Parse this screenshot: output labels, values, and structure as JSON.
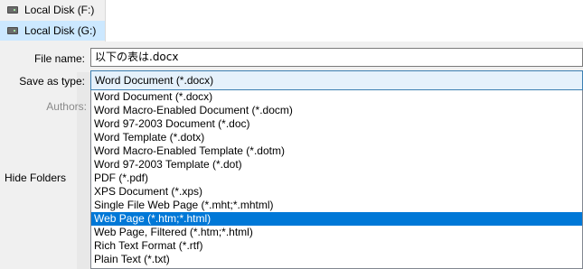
{
  "nav": {
    "items": [
      {
        "label": "Local Disk (F:)",
        "icon": "drive-icon",
        "selected": false
      },
      {
        "label": "Local Disk (G:)",
        "icon": "drive-icon",
        "selected": true
      }
    ]
  },
  "form": {
    "file_name_label": "File name:",
    "file_name_value": "以下の表は.docx",
    "save_as_type_label": "Save as type:",
    "save_as_type_value": "Word Document (*.docx)",
    "authors_label": "Authors:"
  },
  "dropdown": {
    "options": [
      "Word Document (*.docx)",
      "Word Macro-Enabled Document (*.docm)",
      "Word 97-2003 Document (*.doc)",
      "Word Template (*.dotx)",
      "Word Macro-Enabled Template (*.dotm)",
      "Word 97-2003 Template (*.dot)",
      "PDF (*.pdf)",
      "XPS Document (*.xps)",
      "Single File Web Page (*.mht;*.mhtml)",
      "Web Page (*.htm;*.html)",
      "Web Page, Filtered (*.htm;*.html)",
      "Rich Text Format (*.rtf)",
      "Plain Text (*.txt)"
    ],
    "highlighted_index": 9
  },
  "footer": {
    "hide_folders_label": "Hide Folders"
  },
  "colors": {
    "selection": "#0078d7",
    "nav_selected": "#cce8ff",
    "combo_focus": "#e5f1fb"
  }
}
